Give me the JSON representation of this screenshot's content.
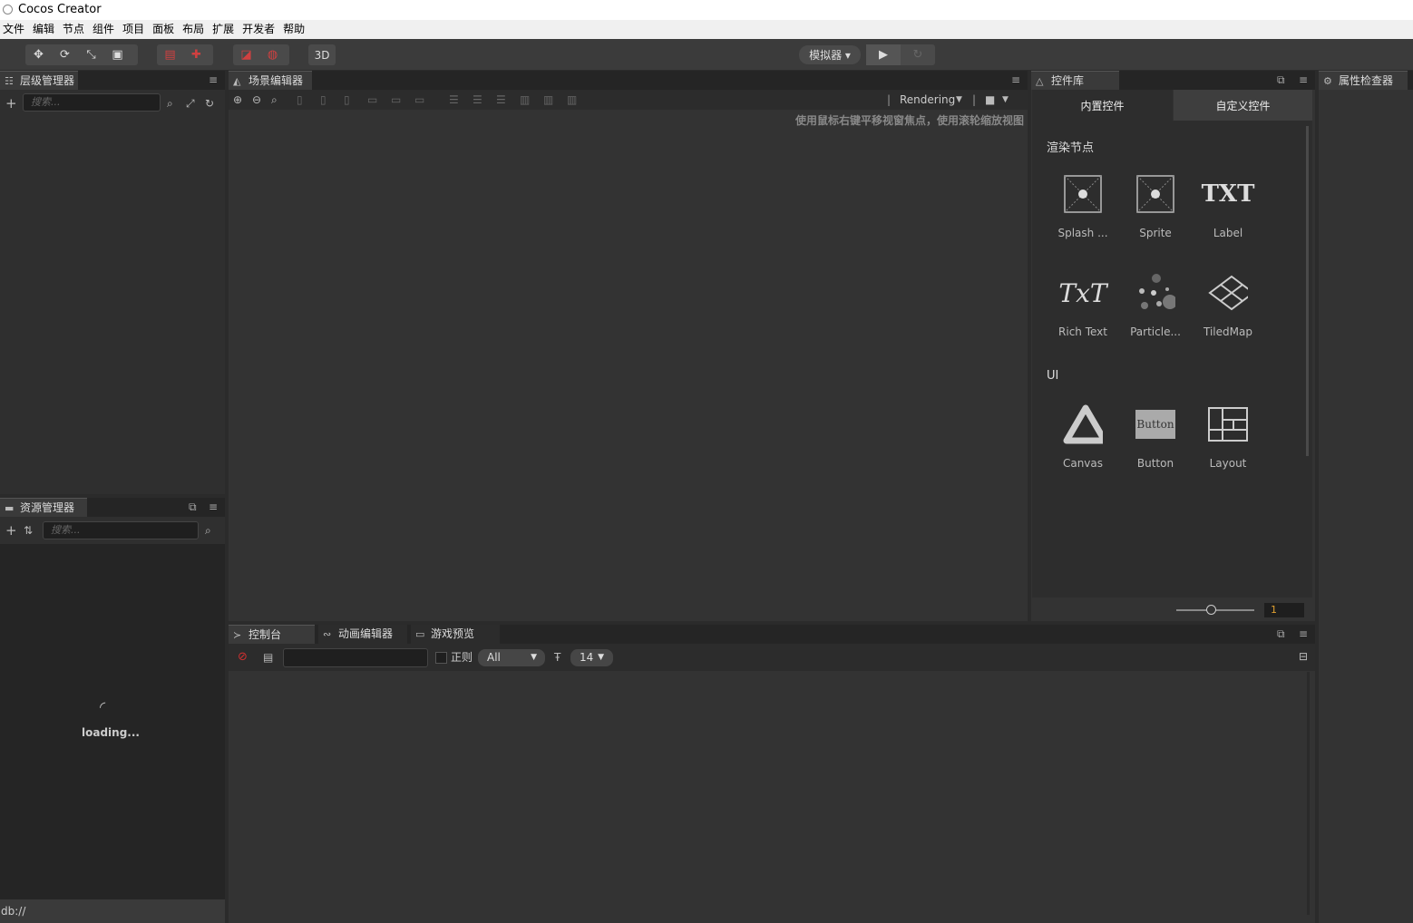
{
  "app": {
    "title": "Cocos Creator"
  },
  "menu": [
    "文件",
    "编辑",
    "节点",
    "组件",
    "项目",
    "面板",
    "布局",
    "扩展",
    "开发者",
    "帮助"
  ],
  "toolbar": {
    "btn_3d": "3D",
    "simulator": "模拟器 ▾"
  },
  "hierarchy": {
    "title": "层级管理器",
    "search_placeholder": "搜索..."
  },
  "assets": {
    "title": "资源管理器",
    "search_placeholder": "搜索...",
    "loading": "loading...",
    "footer": "db://"
  },
  "scene": {
    "title": "场景编辑器",
    "rendering": "Rendering",
    "hint": "使用鼠标右键平移视窗焦点，使用滚轮缩放视图"
  },
  "widgets": {
    "title": "控件库",
    "tabs": [
      "内置控件",
      "自定义控件"
    ],
    "section_render": "渲染节点",
    "section_ui": "UI",
    "render_items": [
      "Splash ...",
      "Sprite",
      "Label",
      "Rich Text",
      "Particle...",
      "TiledMap"
    ],
    "ui_items": [
      "Canvas",
      "Button",
      "Layout"
    ],
    "txt_glyph": "TXT",
    "richtext_glyph": "TxT",
    "button_glyph": "Button",
    "zoom_value": "1"
  },
  "inspector": {
    "title": "属性检查器"
  },
  "console": {
    "tabs": [
      "控制台",
      "动画编辑器",
      "游戏预览"
    ],
    "regex_label": "正则",
    "filter_value": "All",
    "font_size": "14"
  },
  "colors": {
    "bg": "#2f2f2f",
    "tab_active": "#3a3a3a",
    "accent_zoom": "#e0a030"
  }
}
